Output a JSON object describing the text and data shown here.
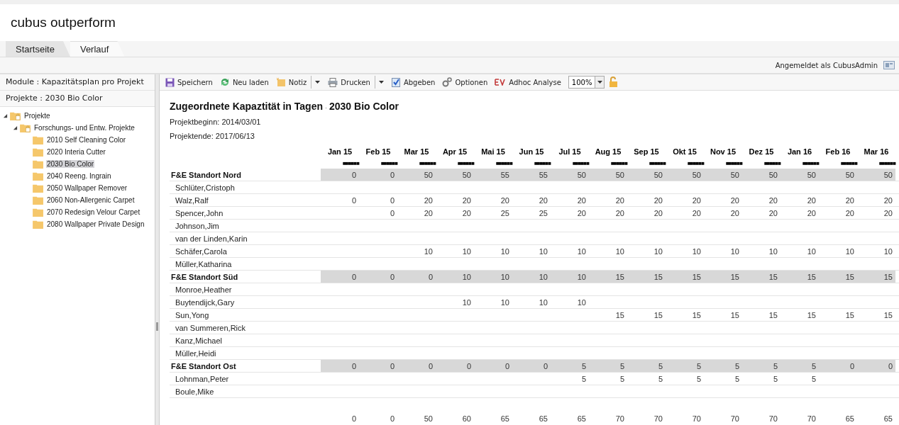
{
  "app_title": "cubus outperform",
  "tabs": [
    {
      "label": "Startseite",
      "selected": false
    },
    {
      "label": "Verlauf",
      "selected": true
    }
  ],
  "user_bar": {
    "text": "Angemeldet als CubusAdmin"
  },
  "sidebar": {
    "module": "Module : Kapazitätsplan pro Projekt",
    "project": "Projekte : 2030 Bio Color",
    "tree": [
      {
        "label": "Projekte",
        "kind": "group",
        "expanded": true,
        "selected": false,
        "children": [
          {
            "label": "Forschungs- und Entw. Projekte",
            "kind": "group",
            "expanded": true,
            "selected": false,
            "children": [
              {
                "label": "2010 Self Cleaning Color",
                "kind": "leaf",
                "selected": false
              },
              {
                "label": "2020 Interia Cutter",
                "kind": "leaf",
                "selected": false
              },
              {
                "label": "2030 Bio Color",
                "kind": "leaf",
                "selected": true
              },
              {
                "label": "2040 Reeng. Ingrain",
                "kind": "leaf",
                "selected": false
              },
              {
                "label": "2050 Wallpaper Remover",
                "kind": "leaf",
                "selected": false
              },
              {
                "label": "2060 Non-Allergenic Carpet",
                "kind": "leaf",
                "selected": false
              },
              {
                "label": "2070 Redesign Velour Carpet",
                "kind": "leaf",
                "selected": false
              },
              {
                "label": "2080 Wallpaper Private Design",
                "kind": "leaf",
                "selected": false
              }
            ]
          }
        ]
      }
    ]
  },
  "toolbar": [
    {
      "kind": "save",
      "label": "Speichern"
    },
    {
      "kind": "reload",
      "label": "Neu laden"
    },
    {
      "kind": "note",
      "label": "Notiz"
    },
    {
      "kind": "dropdown"
    },
    {
      "kind": "print",
      "label": "Drucken"
    },
    {
      "kind": "dropdown"
    },
    {
      "kind": "submit",
      "label": "Abgeben"
    },
    {
      "kind": "options",
      "label": "Optionen"
    },
    {
      "kind": "adhoc",
      "label": "Adhoc Analyse"
    },
    {
      "kind": "zoom",
      "label": "100%"
    },
    {
      "kind": "lock"
    }
  ],
  "report": {
    "title": "Zugeordnete Kapaztität in Tagen",
    "title_sep": "·",
    "project": "2030 Bio Color",
    "begin": "Projektbeginn: 2014/03/01",
    "end": "Projektende: 2017/06/13",
    "columns": [
      {
        "label": "Jan 15",
        "marks": "■■■■■■"
      },
      {
        "label": "Feb 15",
        "marks": "■■■■■■"
      },
      {
        "label": "Mar 15",
        "marks": "■■■■■■"
      },
      {
        "label": "Apr 15",
        "marks": "■■■■■■"
      },
      {
        "label": "Mai 15",
        "marks": "■■■■■■"
      },
      {
        "label": "Jun 15",
        "marks": "■■■■■■"
      },
      {
        "label": "Jul 15",
        "marks": "■■■■■■"
      },
      {
        "label": "Aug 15",
        "marks": "■■■■■■"
      },
      {
        "label": "Sep 15",
        "marks": "■■■■■■"
      },
      {
        "label": "Okt 15",
        "marks": "■■■■■■"
      },
      {
        "label": "Nov 15",
        "marks": "■■■■■■"
      },
      {
        "label": "Dez 15",
        "marks": "■■■■■■"
      },
      {
        "label": "Jan 16",
        "marks": "■■■■■■"
      },
      {
        "label": "Feb 16",
        "marks": "■■■■■■"
      },
      {
        "label": "Mar 16",
        "marks": "■■■■■■"
      }
    ],
    "rows": [
      {
        "kind": "group",
        "name": "F&E Standort Nord",
        "cells": [
          {
            "kind": "value",
            "value": "0"
          },
          {
            "kind": "value",
            "value": "0"
          },
          {
            "kind": "value",
            "value": "50"
          },
          {
            "kind": "value",
            "value": "50"
          },
          {
            "kind": "value",
            "value": "55"
          },
          {
            "kind": "value",
            "value": "55"
          },
          {
            "kind": "value",
            "value": "50"
          },
          {
            "kind": "value",
            "value": "50"
          },
          {
            "kind": "value",
            "value": "50"
          },
          {
            "kind": "value",
            "value": "50"
          },
          {
            "kind": "value",
            "value": "50"
          },
          {
            "kind": "value",
            "value": "50"
          },
          {
            "kind": "value",
            "value": "50"
          },
          {
            "kind": "value",
            "value": "50"
          },
          {
            "kind": "value",
            "value": "50"
          }
        ]
      },
      {
        "kind": "person",
        "name": "Schlüter,Cristoph"
      },
      {
        "kind": "person",
        "name": "Walz,Ralf",
        "cells": [
          {
            "kind": "value",
            "value": "0"
          },
          {
            "kind": "value",
            "value": "0"
          },
          {
            "kind": "value",
            "value": "20"
          },
          {
            "kind": "value",
            "value": "20"
          },
          {
            "kind": "value",
            "value": "20"
          },
          {
            "kind": "value",
            "value": "20"
          },
          {
            "kind": "value",
            "value": "20"
          },
          {
            "kind": "value",
            "value": "20"
          },
          {
            "kind": "value",
            "value": "20"
          },
          {
            "kind": "value",
            "value": "20"
          },
          {
            "kind": "value",
            "value": "20"
          },
          {
            "kind": "value",
            "value": "20"
          },
          {
            "kind": "value",
            "value": "20"
          },
          {
            "kind": "value",
            "value": "20"
          },
          {
            "kind": "value",
            "value": "20"
          }
        ]
      },
      {
        "kind": "person",
        "name": "Spencer,John",
        "cells": [
          {
            "kind": "empty"
          },
          {
            "kind": "value",
            "value": "0"
          },
          {
            "kind": "value",
            "value": "20"
          },
          {
            "kind": "value",
            "value": "20"
          },
          {
            "kind": "value",
            "value": "25"
          },
          {
            "kind": "value",
            "value": "25"
          },
          {
            "kind": "value",
            "value": "20"
          },
          {
            "kind": "value",
            "value": "20"
          },
          {
            "kind": "value",
            "value": "20"
          },
          {
            "kind": "value",
            "value": "20"
          },
          {
            "kind": "value",
            "value": "20"
          },
          {
            "kind": "value",
            "value": "20"
          },
          {
            "kind": "value",
            "value": "20"
          },
          {
            "kind": "value",
            "value": "20"
          },
          {
            "kind": "value",
            "value": "20"
          }
        ]
      },
      {
        "kind": "person",
        "name": "Johnson,Jim"
      },
      {
        "kind": "person",
        "name": "van der Linden,Karin"
      },
      {
        "kind": "person",
        "name": "Schäfer,Carola",
        "cells": [
          {
            "kind": "empty"
          },
          {
            "kind": "empty"
          },
          {
            "kind": "value",
            "value": "10"
          },
          {
            "kind": "value",
            "value": "10"
          },
          {
            "kind": "value",
            "value": "10"
          },
          {
            "kind": "value",
            "value": "10"
          },
          {
            "kind": "value",
            "value": "10"
          },
          {
            "kind": "value",
            "value": "10"
          },
          {
            "kind": "value",
            "value": "10"
          },
          {
            "kind": "value",
            "value": "10"
          },
          {
            "kind": "value",
            "value": "10"
          },
          {
            "kind": "value",
            "value": "10"
          },
          {
            "kind": "value",
            "value": "10"
          },
          {
            "kind": "value",
            "value": "10"
          },
          {
            "kind": "value",
            "value": "10"
          }
        ]
      },
      {
        "kind": "person",
        "name": "Müller,Katharina"
      },
      {
        "kind": "group",
        "name": "F&E Standort Süd",
        "cells": [
          {
            "kind": "value",
            "value": "0"
          },
          {
            "kind": "value",
            "value": "0"
          },
          {
            "kind": "value",
            "value": "0"
          },
          {
            "kind": "value",
            "value": "10"
          },
          {
            "kind": "value",
            "value": "10"
          },
          {
            "kind": "value",
            "value": "10"
          },
          {
            "kind": "value",
            "value": "10"
          },
          {
            "kind": "value",
            "value": "15"
          },
          {
            "kind": "value",
            "value": "15"
          },
          {
            "kind": "value",
            "value": "15"
          },
          {
            "kind": "value",
            "value": "15"
          },
          {
            "kind": "value",
            "value": "15"
          },
          {
            "kind": "value",
            "value": "15"
          },
          {
            "kind": "value",
            "value": "15"
          },
          {
            "kind": "value",
            "value": "15"
          }
        ]
      },
      {
        "kind": "person",
        "name": "Monroe,Heather"
      },
      {
        "kind": "person",
        "name": "Buytendijck,Gary",
        "cells": [
          {
            "kind": "empty"
          },
          {
            "kind": "empty"
          },
          {
            "kind": "empty"
          },
          {
            "kind": "value",
            "value": "10"
          },
          {
            "kind": "value",
            "value": "10"
          },
          {
            "kind": "value",
            "value": "10"
          },
          {
            "kind": "value",
            "value": "10"
          }
        ]
      },
      {
        "kind": "person",
        "name": "Sun,Yong",
        "cells": [
          {
            "kind": "empty"
          },
          {
            "kind": "empty"
          },
          {
            "kind": "empty"
          },
          {
            "kind": "empty"
          },
          {
            "kind": "empty"
          },
          {
            "kind": "empty"
          },
          {
            "kind": "empty"
          },
          {
            "kind": "value",
            "value": "15"
          },
          {
            "kind": "value",
            "value": "15"
          },
          {
            "kind": "value",
            "value": "15"
          },
          {
            "kind": "value",
            "value": "15"
          },
          {
            "kind": "value",
            "value": "15"
          },
          {
            "kind": "value",
            "value": "15"
          },
          {
            "kind": "value",
            "value": "15"
          },
          {
            "kind": "value",
            "value": "15"
          }
        ]
      },
      {
        "kind": "person",
        "name": "van Summeren,Rick"
      },
      {
        "kind": "person",
        "name": "Kanz,Michael"
      },
      {
        "kind": "person",
        "name": "Müller,Heidi"
      },
      {
        "kind": "group",
        "name": "F&E Standort Ost",
        "cells": [
          {
            "kind": "value",
            "value": "0"
          },
          {
            "kind": "value",
            "value": "0"
          },
          {
            "kind": "value",
            "value": "0"
          },
          {
            "kind": "value",
            "value": "0"
          },
          {
            "kind": "value",
            "value": "0"
          },
          {
            "kind": "value",
            "value": "0"
          },
          {
            "kind": "value",
            "value": "5"
          },
          {
            "kind": "value",
            "value": "5"
          },
          {
            "kind": "value",
            "value": "5"
          },
          {
            "kind": "value",
            "value": "5"
          },
          {
            "kind": "value",
            "value": "5"
          },
          {
            "kind": "value",
            "value": "5"
          },
          {
            "kind": "value",
            "value": "5"
          },
          {
            "kind": "value",
            "value": "0"
          },
          {
            "kind": "value",
            "value": "0"
          }
        ]
      },
      {
        "kind": "person",
        "name": "Lohnman,Peter",
        "cells": [
          {
            "kind": "empty"
          },
          {
            "kind": "empty"
          },
          {
            "kind": "empty"
          },
          {
            "kind": "empty"
          },
          {
            "kind": "empty"
          },
          {
            "kind": "empty"
          },
          {
            "kind": "value",
            "value": "5"
          },
          {
            "kind": "value",
            "value": "5"
          },
          {
            "kind": "value",
            "value": "5"
          },
          {
            "kind": "value",
            "value": "5"
          },
          {
            "kind": "value",
            "value": "5"
          },
          {
            "kind": "value",
            "value": "5"
          },
          {
            "kind": "value",
            "value": "5"
          }
        ]
      },
      {
        "kind": "person",
        "name": "Boule,Mike"
      },
      {
        "kind": "total",
        "cells": [
          {
            "kind": "value",
            "value": "0"
          },
          {
            "kind": "value",
            "value": "0"
          },
          {
            "kind": "value",
            "value": "50"
          },
          {
            "kind": "value",
            "value": "60"
          },
          {
            "kind": "value",
            "value": "65"
          },
          {
            "kind": "value",
            "value": "65"
          },
          {
            "kind": "value",
            "value": "65"
          },
          {
            "kind": "value",
            "value": "70"
          },
          {
            "kind": "value",
            "value": "70"
          },
          {
            "kind": "value",
            "value": "70"
          },
          {
            "kind": "value",
            "value": "70"
          },
          {
            "kind": "value",
            "value": "70"
          },
          {
            "kind": "value",
            "value": "70"
          },
          {
            "kind": "value",
            "value": "65"
          },
          {
            "kind": "value",
            "value": "65"
          }
        ]
      }
    ]
  }
}
